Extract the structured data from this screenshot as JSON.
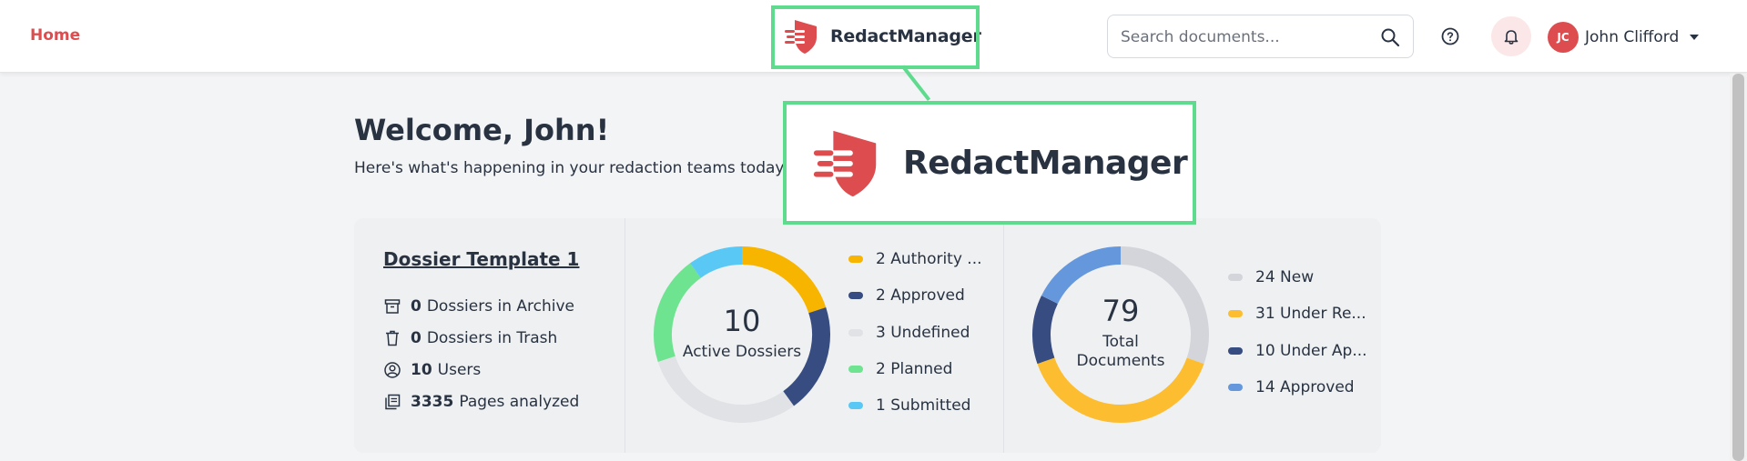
{
  "nav": {
    "home_label": "Home",
    "brand_name": "RedactManager",
    "search_placeholder": "Search documents...",
    "user_initials": "JC",
    "user_name": "John Clifford"
  },
  "welcome": {
    "title": "Welcome, John!",
    "subtitle": "Here's what's happening in your redaction teams today."
  },
  "template": {
    "title": "Dossier Template 1",
    "stats": [
      {
        "value": "0",
        "label": "Dossiers in Archive",
        "icon": "archive-icon"
      },
      {
        "value": "0",
        "label": "Dossiers in Trash",
        "icon": "trash-icon"
      },
      {
        "value": "10",
        "label": "Users",
        "icon": "user-circle-icon"
      },
      {
        "value": "3335",
        "label": "Pages analyzed",
        "icon": "pages-icon"
      }
    ]
  },
  "dossiers_chart": {
    "center_value": "10",
    "center_label": "Active Dossiers",
    "segments": [
      {
        "label": "2 Authority ...",
        "value": 2,
        "color": "#f7b500"
      },
      {
        "label": "2 Approved",
        "value": 2,
        "color": "#374c81"
      },
      {
        "label": "3 Undefined",
        "value": 3,
        "color": "#e1e2e6"
      },
      {
        "label": "2 Planned",
        "value": 2,
        "color": "#6ee390"
      },
      {
        "label": "1 Submitted",
        "value": 1,
        "color": "#5ac8f5"
      }
    ]
  },
  "documents_chart": {
    "center_value": "79",
    "center_label_line1": "Total",
    "center_label_line2": "Documents",
    "segments": [
      {
        "label": "24 New",
        "value": 24,
        "color": "#d3d5da"
      },
      {
        "label": "31 Under Re...",
        "value": 31,
        "color": "#fdbd30"
      },
      {
        "label": "10 Under Ap...",
        "value": 10,
        "color": "#374c81"
      },
      {
        "label": "14 Approved",
        "value": 14,
        "color": "#6597dd"
      }
    ]
  },
  "zoom": {
    "brand_name": "RedactManager"
  },
  "colors": {
    "accent": "#dd4d50",
    "highlight": "#5fdb8e"
  }
}
